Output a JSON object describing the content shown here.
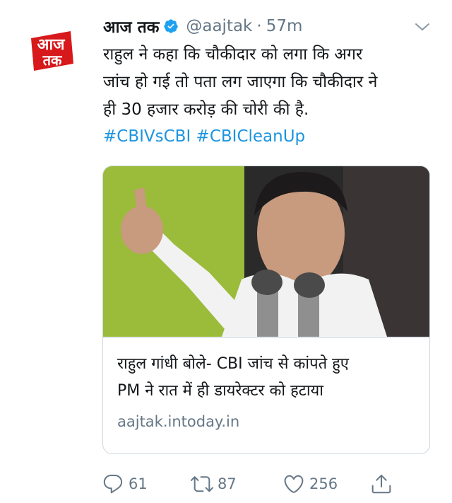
{
  "tweet": {
    "author": {
      "display_name": "आज तक",
      "handle": "@aajtak",
      "verified": true,
      "avatar_text_top": "आज",
      "avatar_text_bottom": "तक"
    },
    "separator": "·",
    "time": "57m",
    "text_lines": [
      "राहुल ने कहा कि चौकीदार को लगा कि अगर",
      "जांच हो गई तो पता लग जाएगा कि चौकीदार ने",
      "ही 30 हजार करोड़ की चोरी की है."
    ],
    "hashtags": [
      "#CBIVsCBI",
      "#CBICleanUp"
    ],
    "card": {
      "image_alt": "photo-of-speaker-at-microphones",
      "title_lines": [
        "राहुल गांधी बोले- CBI जांच से कांपते हुए",
        "PM ने रात में ही डायरेक्टर को हटाया"
      ],
      "domain": "aajtak.intoday.in"
    },
    "actions": {
      "replies": "61",
      "retweets": "87",
      "likes": "256"
    }
  },
  "colors": {
    "link": "#1b95e0",
    "muted": "#657786",
    "text": "#14171a",
    "verified": "#1da1f2",
    "brand_red": "#d7191c",
    "border": "#ccd6dd"
  },
  "icons": {
    "verified": "verified-badge-icon",
    "caret": "chevron-down-icon",
    "reply": "reply-icon",
    "retweet": "retweet-icon",
    "like": "heart-icon",
    "share": "share-icon"
  }
}
